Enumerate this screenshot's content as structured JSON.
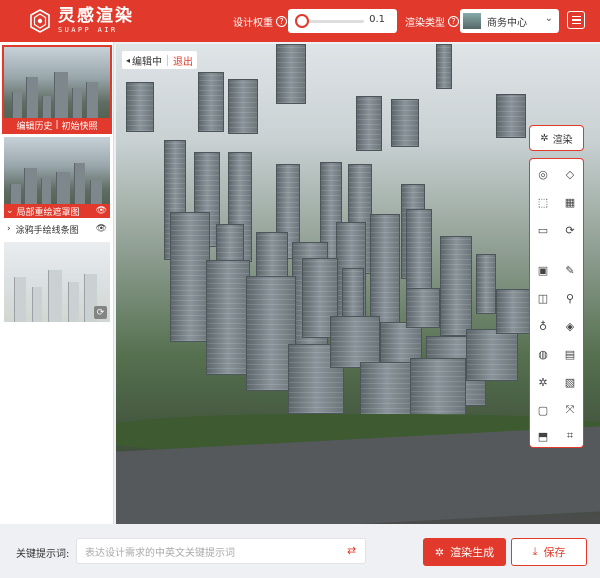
{
  "header": {
    "brand_cn": "灵感渲染",
    "brand_en": "SUAPP AIR",
    "weight_label": "设计权重",
    "weight_value": "0.1",
    "type_label": "渲染类型",
    "type_value": "商务中心"
  },
  "sidebar": {
    "history_label": "编辑历史",
    "initial_label": "初始快照",
    "sep": "|",
    "mask_label": "局部重绘遮罩图",
    "sketch_label": "涂鸦手绘线条图"
  },
  "canvas": {
    "editing_label": "编辑中",
    "exit_label": "退出"
  },
  "tools": {
    "render_label": "渲染"
  },
  "bottom": {
    "keyword_label": "关键提示词:",
    "keyword_placeholder": "表达设计需求的中英文关键提示词",
    "generate_label": "渲染生成",
    "save_label": "保存"
  }
}
